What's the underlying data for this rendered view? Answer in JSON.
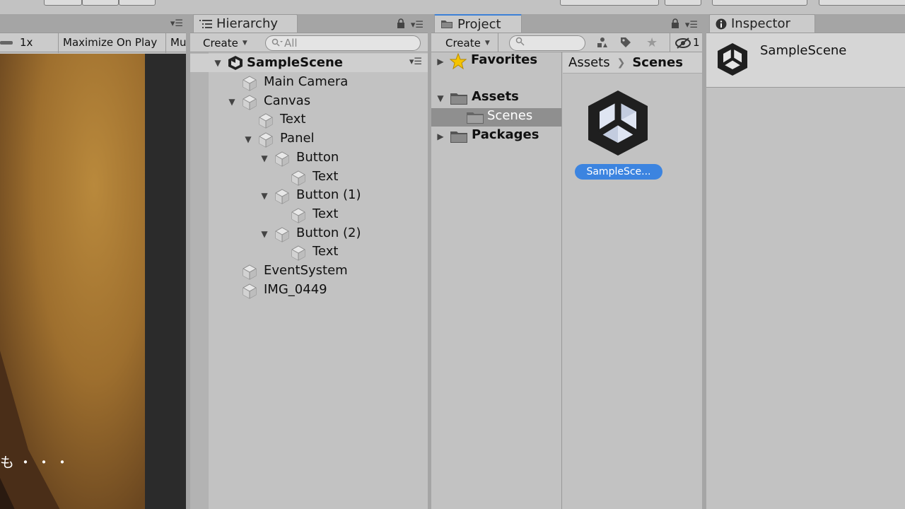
{
  "game": {
    "scale_label": "1x",
    "maximize_label": "Maximize On Play",
    "mute_label": "Mu",
    "overlay_text": "も・・・"
  },
  "hierarchy": {
    "tab_title": "Hierarchy",
    "create_label": "Create",
    "search_placeholder": "All",
    "scene_name": "SampleScene",
    "items": [
      {
        "label": "Main Camera",
        "depth": 0,
        "foldout": "none"
      },
      {
        "label": "Canvas",
        "depth": 0,
        "foldout": "expanded"
      },
      {
        "label": "Text",
        "depth": 1,
        "foldout": "none"
      },
      {
        "label": "Panel",
        "depth": 1,
        "foldout": "expanded"
      },
      {
        "label": "Button",
        "depth": 2,
        "foldout": "expanded"
      },
      {
        "label": "Text",
        "depth": 3,
        "foldout": "none"
      },
      {
        "label": "Button (1)",
        "depth": 2,
        "foldout": "expanded"
      },
      {
        "label": "Text",
        "depth": 3,
        "foldout": "none"
      },
      {
        "label": "Button (2)",
        "depth": 2,
        "foldout": "expanded"
      },
      {
        "label": "Text",
        "depth": 3,
        "foldout": "none"
      },
      {
        "label": "EventSystem",
        "depth": 0,
        "foldout": "none"
      },
      {
        "label": "IMG_0449",
        "depth": 0,
        "foldout": "none"
      }
    ]
  },
  "project": {
    "tab_title": "Project",
    "create_label": "Create",
    "hidden_count_label": "1",
    "favorites_label": "Favorites",
    "assets_label": "Assets",
    "scenes_folder_label": "Scenes",
    "packages_label": "Packages",
    "breadcrumb": [
      "Assets",
      "Scenes"
    ],
    "asset_item_label": "SampleSce..."
  },
  "inspector": {
    "tab_title": "Inspector",
    "object_name": "SampleScene"
  },
  "colors": {
    "selection_blue": "#3c84e0",
    "panel_bg": "#c2c2c2",
    "favorites_star": "#f5c400"
  }
}
